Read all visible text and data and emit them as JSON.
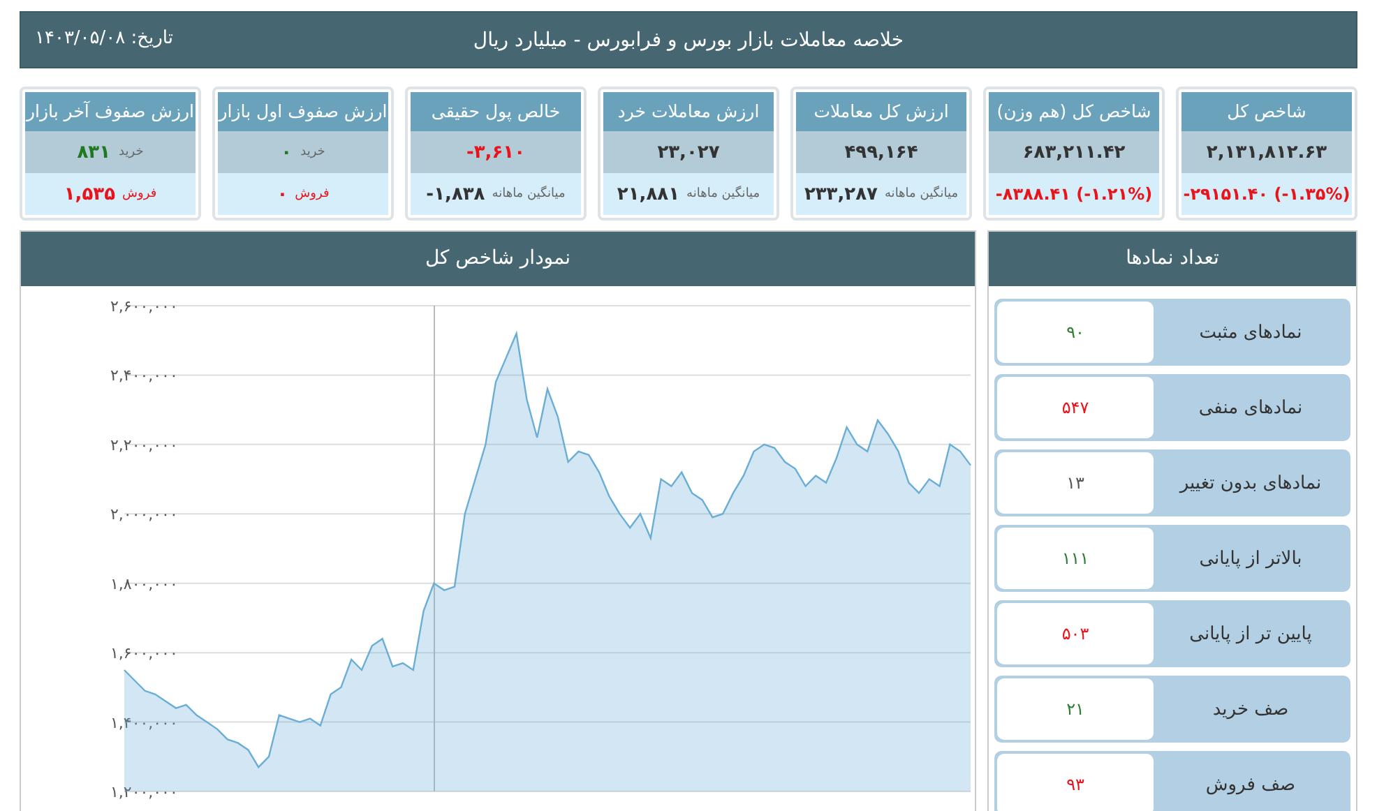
{
  "header": {
    "title": "خلاصه معاملات بازار بورس و فرابورس - میلیارد ریال",
    "date": "تاریخ: ۱۴۰۳/۰۵/۰۸"
  },
  "cards": [
    {
      "kind": "change",
      "title": "شاخص کل",
      "value": "۲,۱۳۱,۸۱۲.۶۳",
      "change": "-۲۹۱۵۱.۴۰ (-۱.۳۵%)",
      "negative": true
    },
    {
      "kind": "change",
      "title": "شاخص کل (هم وزن)",
      "value": "۶۸۳,۲۱۱.۴۲",
      "change": "-۸۳۸۸.۴۱ (-۱.۲۱%)",
      "negative": true
    },
    {
      "kind": "average",
      "title": "ارزش کل معاملات",
      "value": "۴۹۹,۱۶۴",
      "negative": false,
      "avg_label": "میانگین ماهانه",
      "avg_value": "۲۳۳,۲۸۷"
    },
    {
      "kind": "average",
      "title": "ارزش معاملات خرد",
      "value": "۲۳,۰۲۷",
      "negative": false,
      "avg_label": "میانگین ماهانه",
      "avg_value": "۲۱,۸۸۱"
    },
    {
      "kind": "average",
      "title": "خالص پول حقیقی",
      "value": "-۳,۶۱۰",
      "negative": true,
      "avg_label": "میانگین ماهانه",
      "avg_value": "-۱,۸۳۸"
    },
    {
      "kind": "queue",
      "title": "ارزش صفوف اول بازار",
      "buy_label": "خرید",
      "buy_value": "۰",
      "sell_label": "فروش",
      "sell_value": "۰"
    },
    {
      "kind": "queue",
      "title": "ارزش صفوف آخر بازار",
      "buy_label": "خرید",
      "buy_value": "۸۳۱",
      "sell_label": "فروش",
      "sell_value": "۱,۵۳۵"
    }
  ],
  "chart_panel": {
    "title": "نمودار شاخص کل",
    "chart_data": {
      "type": "area",
      "ylim": [
        1200000,
        2600000
      ],
      "yticks": [
        {
          "value": 1200000,
          "label": "۱,۲۰۰,۰۰۰"
        },
        {
          "value": 1400000,
          "label": "۱,۴۰۰,۰۰۰"
        },
        {
          "value": 1600000,
          "label": "۱,۶۰۰,۰۰۰"
        },
        {
          "value": 1800000,
          "label": "۱,۸۰۰,۰۰۰"
        },
        {
          "value": 2000000,
          "label": "۲,۰۰۰,۰۰۰"
        },
        {
          "value": 2200000,
          "label": "۲,۲۰۰,۰۰۰"
        },
        {
          "value": 2400000,
          "label": "۲,۴۰۰,۰۰۰"
        },
        {
          "value": 2600000,
          "label": "۲,۶۰۰,۰۰۰"
        }
      ],
      "grid": true,
      "series": [
        {
          "color": "#6aaed6",
          "values": [
            1550000,
            1520000,
            1490000,
            1480000,
            1460000,
            1440000,
            1450000,
            1420000,
            1400000,
            1380000,
            1350000,
            1340000,
            1320000,
            1270000,
            1300000,
            1420000,
            1410000,
            1400000,
            1410000,
            1390000,
            1480000,
            1500000,
            1580000,
            1550000,
            1620000,
            1640000,
            1560000,
            1570000,
            1550000,
            1720000,
            1800000,
            1780000,
            1790000,
            2000000,
            2100000,
            2200000,
            2380000,
            2450000,
            2520000,
            2330000,
            2220000,
            2360000,
            2280000,
            2150000,
            2180000,
            2170000,
            2120000,
            2050000,
            2000000,
            1960000,
            2000000,
            1930000,
            2100000,
            2080000,
            2120000,
            2060000,
            2040000,
            1990000,
            2000000,
            2060000,
            2110000,
            2180000,
            2200000,
            2190000,
            2150000,
            2130000,
            2080000,
            2110000,
            2090000,
            2160000,
            2250000,
            2200000,
            2180000,
            2270000,
            2230000,
            2180000,
            2090000,
            2060000,
            2100000,
            2080000,
            2200000,
            2180000,
            2140000
          ]
        }
      ]
    }
  },
  "counts_panel": {
    "title": "تعداد نمادها",
    "items": [
      {
        "label": "نمادهای مثبت",
        "value": "۹۰",
        "color": "#2e7d32"
      },
      {
        "label": "نمادهای منفی",
        "value": "۵۴۷",
        "color": "#e8141b"
      },
      {
        "label": "نمادهای بدون تغییر",
        "value": "۱۳",
        "color": "#555555"
      },
      {
        "label": "بالاتر از پایانی",
        "value": "۱۱۱",
        "color": "#2e7d32"
      },
      {
        "label": "پایین تر از پایانی",
        "value": "۵۰۳",
        "color": "#e8141b"
      },
      {
        "label": "صف خرید",
        "value": "۲۱",
        "color": "#2e7d32"
      },
      {
        "label": "صف فروش",
        "value": "۹۳",
        "color": "#e8141b"
      }
    ]
  }
}
